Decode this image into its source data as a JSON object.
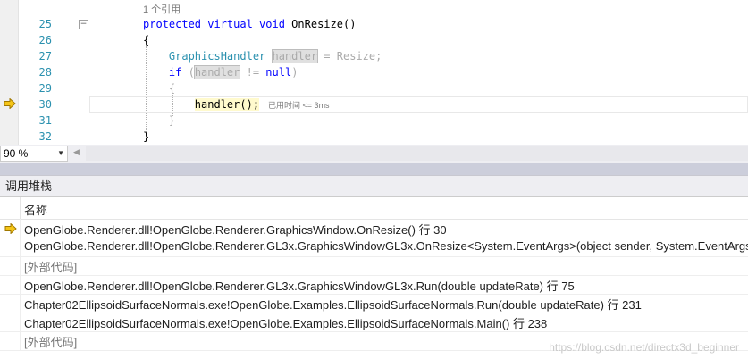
{
  "editor": {
    "codelens": "1 个引用",
    "lines": [
      {
        "num": "25",
        "tokens": [
          {
            "t": "protected ",
            "c": "kw"
          },
          {
            "t": "virtual ",
            "c": "kw"
          },
          {
            "t": "void ",
            "c": "kw"
          },
          {
            "t": "OnResize()",
            "c": "plain"
          }
        ]
      },
      {
        "num": "26",
        "tokens": [
          {
            "t": "{",
            "c": "plain"
          }
        ]
      },
      {
        "num": "27",
        "tokens": [
          {
            "t": "    GraphicsHandler ",
            "c": "ty"
          },
          {
            "t": "handler",
            "c": "dim hl"
          },
          {
            "t": " = Resize;",
            "c": "dim"
          }
        ]
      },
      {
        "num": "28",
        "tokens": [
          {
            "t": "    if ",
            "c": "kw"
          },
          {
            "t": "(",
            "c": "dim"
          },
          {
            "t": "handler",
            "c": "dim hl"
          },
          {
            "t": " != ",
            "c": "dim"
          },
          {
            "t": "null",
            "c": "kw"
          },
          {
            "t": ")",
            "c": "dim"
          }
        ]
      },
      {
        "num": "29",
        "tokens": [
          {
            "t": "    {",
            "c": "dim"
          }
        ]
      },
      {
        "num": "30",
        "tokens": [
          {
            "t": "        ",
            "c": "plain"
          },
          {
            "t": "handler();",
            "c": "plain curline"
          }
        ],
        "perf": "已用时间 <= 3ms"
      },
      {
        "num": "31",
        "tokens": [
          {
            "t": "    }",
            "c": "dim"
          }
        ]
      },
      {
        "num": "32",
        "tokens": [
          {
            "t": "}",
            "c": "plain"
          }
        ]
      }
    ]
  },
  "zoom": {
    "value": "90 %"
  },
  "callstack": {
    "title": "调用堆栈",
    "column_header": "名称",
    "rows": [
      {
        "text": "OpenGlobe.Renderer.dll!OpenGlobe.Renderer.GraphicsWindow.OnResize() 行 30",
        "current": true,
        "external": false
      },
      {
        "text": "OpenGlobe.Renderer.dll!OpenGlobe.Renderer.GL3x.GraphicsWindowGL3x.OnResize<System.EventArgs>(object sender, System.EventArgs e)",
        "current": false,
        "external": false
      },
      {
        "text": "[外部代码]",
        "current": false,
        "external": true
      },
      {
        "text": "OpenGlobe.Renderer.dll!OpenGlobe.Renderer.GL3x.GraphicsWindowGL3x.Run(double updateRate) 行 75",
        "current": false,
        "external": false
      },
      {
        "text": "Chapter02EllipsoidSurfaceNormals.exe!OpenGlobe.Examples.EllipsoidSurfaceNormals.Run(double updateRate) 行 231",
        "current": false,
        "external": false
      },
      {
        "text": "Chapter02EllipsoidSurfaceNormals.exe!OpenGlobe.Examples.EllipsoidSurfaceNormals.Main() 行 238",
        "current": false,
        "external": false
      },
      {
        "text": "[外部代码]",
        "current": false,
        "external": true
      }
    ]
  },
  "watermark": "https://blog.csdn.net/directx3d_beginner",
  "colors": {
    "keyword": "#0000ff",
    "type": "#2b91af",
    "linenumber": "#2b91af",
    "current_line": "#fffacd",
    "arrow": "#f5c518"
  },
  "icons": {
    "current_statement": "yellow-arrow-icon",
    "fold": "collapse-minus-icon"
  }
}
